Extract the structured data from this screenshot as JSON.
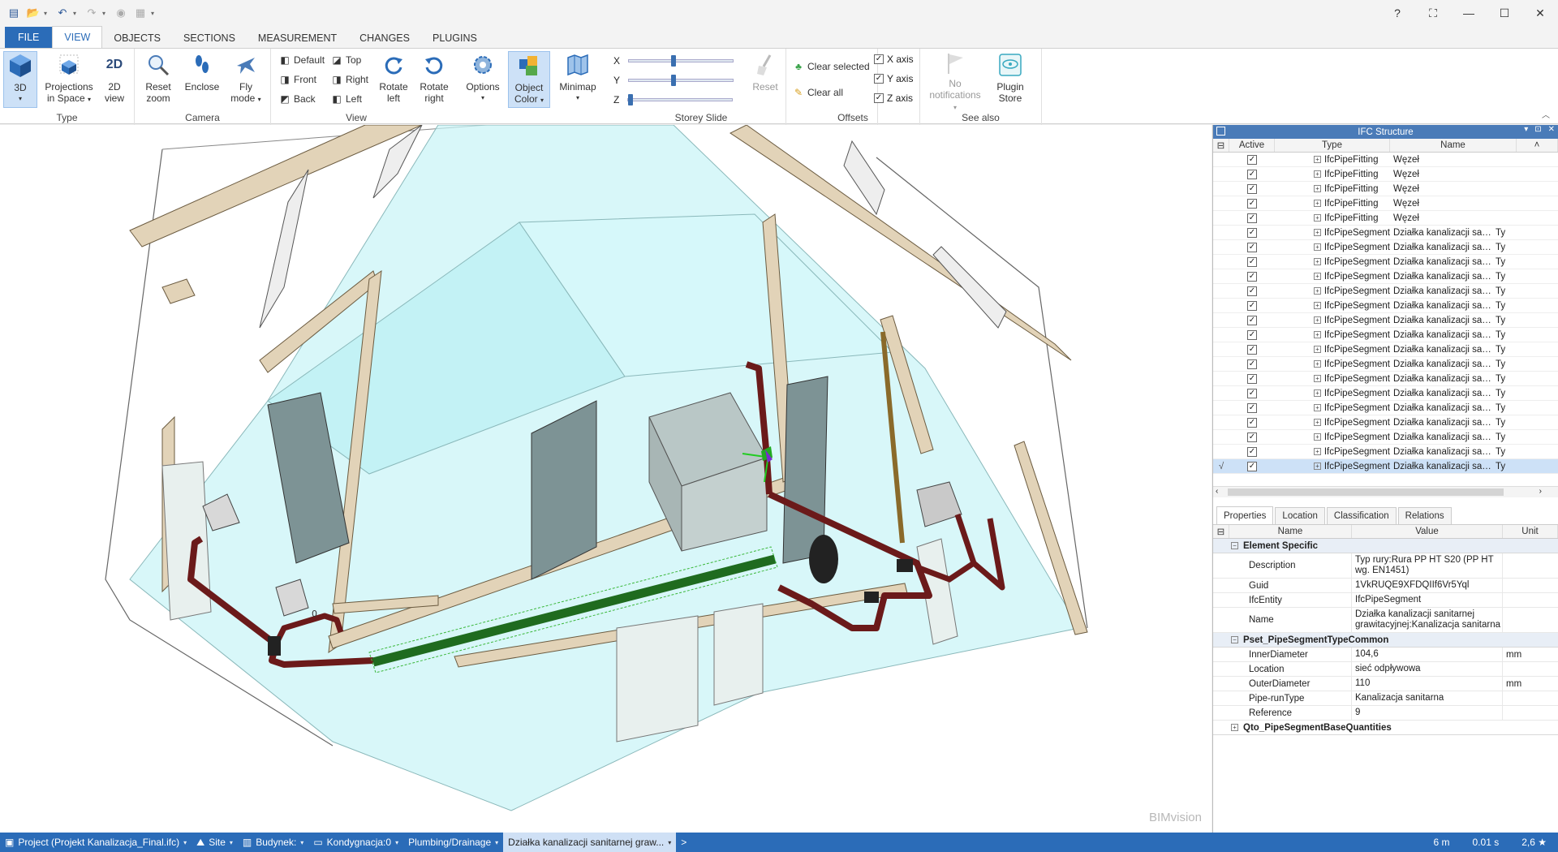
{
  "ribbon_tabs": [
    "FILE",
    "VIEW",
    "OBJECTS",
    "SECTIONS",
    "MEASUREMENT",
    "CHANGES",
    "PLUGINS"
  ],
  "active_tab": "VIEW",
  "groups": {
    "type": {
      "label": "Type",
      "btn_3d": "3D",
      "btn_proj_1": "Projections",
      "btn_proj_2": "in Space",
      "btn_2d_icon": "2D",
      "btn_2d_1": "2D",
      "btn_2d_2": "view"
    },
    "camera": {
      "label": "Camera",
      "reset_1": "Reset",
      "reset_2": "zoom",
      "enclose": "Enclose",
      "fly_1": "Fly",
      "fly_2": "mode"
    },
    "view": {
      "label": "View",
      "default": "Default",
      "front": "Front",
      "back": "Back",
      "top": "Top",
      "right": "Right",
      "left": "Left",
      "rotl_1": "Rotate",
      "rotl_2": "left",
      "rotr_1": "Rotate",
      "rotr_2": "right",
      "options": "Options",
      "objcol_1": "Object",
      "objcol_2": "Color",
      "minimap": "Minimap"
    },
    "storey": {
      "label": "Storey Slide",
      "x": "X",
      "y": "Y",
      "z": "Z",
      "reset": "Reset",
      "x_level": 0.42,
      "y_level": 0.42,
      "z_level": 0.0
    },
    "offsets": {
      "label": "Offsets",
      "clear_selected": "Clear selected",
      "clear_all": "Clear all",
      "x_axis": "X axis",
      "y_axis": "Y axis",
      "z_axis": "Z axis",
      "x_checked": true,
      "y_checked": true,
      "z_checked": true
    },
    "see_also": {
      "label": "See also",
      "notif_1": "No",
      "notif_2": "notifications",
      "plugin_1": "Plugin",
      "plugin_2": "Store"
    }
  },
  "viewport": {
    "watermark": "BIMvision"
  },
  "ifc_panel": {
    "title": "IFC Structure",
    "columns": {
      "active": "Active",
      "type": "Type",
      "name": "Name"
    },
    "rows": [
      {
        "type": "IfcPipeFitting",
        "name": "Węzeł",
        "extra": ""
      },
      {
        "type": "IfcPipeFitting",
        "name": "Węzeł",
        "extra": ""
      },
      {
        "type": "IfcPipeFitting",
        "name": "Węzeł",
        "extra": ""
      },
      {
        "type": "IfcPipeFitting",
        "name": "Węzeł",
        "extra": ""
      },
      {
        "type": "IfcPipeFitting",
        "name": "Węzeł",
        "extra": ""
      },
      {
        "type": "IfcPipeSegment",
        "name": "Działka kanalizacji sani...",
        "extra": "Ty"
      },
      {
        "type": "IfcPipeSegment",
        "name": "Działka kanalizacji sani...",
        "extra": "Ty"
      },
      {
        "type": "IfcPipeSegment",
        "name": "Działka kanalizacji sani...",
        "extra": "Ty"
      },
      {
        "type": "IfcPipeSegment",
        "name": "Działka kanalizacji sani...",
        "extra": "Ty"
      },
      {
        "type": "IfcPipeSegment",
        "name": "Działka kanalizacji sani...",
        "extra": "Ty"
      },
      {
        "type": "IfcPipeSegment",
        "name": "Działka kanalizacji sani...",
        "extra": "Ty"
      },
      {
        "type": "IfcPipeSegment",
        "name": "Działka kanalizacji sani...",
        "extra": "Ty"
      },
      {
        "type": "IfcPipeSegment",
        "name": "Działka kanalizacji sani...",
        "extra": "Ty"
      },
      {
        "type": "IfcPipeSegment",
        "name": "Działka kanalizacji sani...",
        "extra": "Ty"
      },
      {
        "type": "IfcPipeSegment",
        "name": "Działka kanalizacji sani...",
        "extra": "Ty"
      },
      {
        "type": "IfcPipeSegment",
        "name": "Działka kanalizacji sani...",
        "extra": "Ty"
      },
      {
        "type": "IfcPipeSegment",
        "name": "Działka kanalizacji sani...",
        "extra": "Ty"
      },
      {
        "type": "IfcPipeSegment",
        "name": "Działka kanalizacji sani...",
        "extra": "Ty"
      },
      {
        "type": "IfcPipeSegment",
        "name": "Działka kanalizacji sani...",
        "extra": "Ty"
      },
      {
        "type": "IfcPipeSegment",
        "name": "Działka kanalizacji sani...",
        "extra": "Ty"
      },
      {
        "type": "IfcPipeSegment",
        "name": "Działka kanalizacji sani...",
        "extra": "Ty"
      },
      {
        "type": "IfcPipeSegment",
        "name": "Działka kanalizacji sani...",
        "extra": "Ty"
      }
    ],
    "selected_mark": "√"
  },
  "props_panel": {
    "tabs": [
      "Properties",
      "Location",
      "Classification",
      "Relations"
    ],
    "columns": {
      "name": "Name",
      "value": "Value",
      "unit": "Unit"
    },
    "groups": [
      {
        "title": "Element Specific",
        "rows": [
          {
            "name": "Description",
            "value": "Typ rury:Rura PP HT S20 (PP HT wg. EN1451)",
            "unit": ""
          },
          {
            "name": "Guid",
            "value": "1VkRUQE9XFDQIIf6Vr5Yql",
            "unit": ""
          },
          {
            "name": "IfcEntity",
            "value": "IfcPipeSegment",
            "unit": ""
          },
          {
            "name": "Name",
            "value": "Działka kanalizacji sanitarnej grawitacyjnej:Kanalizacja sanitarna",
            "unit": ""
          }
        ]
      },
      {
        "title": "Pset_PipeSegmentTypeCommon",
        "rows": [
          {
            "name": "InnerDiameter",
            "value": "104,6",
            "unit": "mm"
          },
          {
            "name": "Location",
            "value": "sieć odpływowa",
            "unit": ""
          },
          {
            "name": "OuterDiameter",
            "value": "110",
            "unit": "mm"
          },
          {
            "name": "Pipe-runType",
            "value": "Kanalizacja sanitarna",
            "unit": ""
          },
          {
            "name": "Reference",
            "value": "9",
            "unit": ""
          }
        ]
      },
      {
        "title": "Qto_PipeSegmentBaseQuantities",
        "rows": []
      }
    ]
  },
  "statusbar": {
    "project": "Project (Projekt Kanalizacja_Final.ifc)",
    "site": "Site",
    "building": "Budynek:",
    "storey": "Kondygnacja:0",
    "system": "Plumbing/Drainage",
    "selection": "Działka kanalizacji sanitarnej graw...",
    "more": ">",
    "scale": "6 m",
    "time": "0.01 s",
    "fps": "2,6 ★"
  },
  "colors": {
    "accent": "#2b6cb8",
    "selected_bg": "#cde1f7",
    "room_glass": "#c8f4f6",
    "wall_trim": "#e2d3b8",
    "pipe": "#6b1a1a",
    "selected_pipe": "#1f6b1f"
  }
}
